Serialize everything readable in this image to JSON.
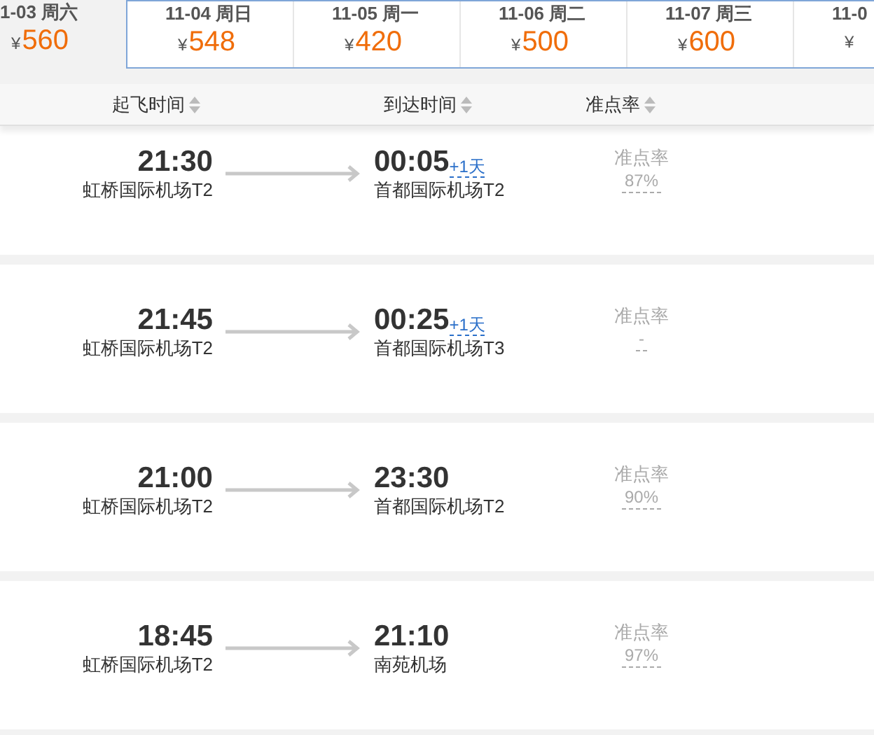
{
  "dates": [
    {
      "date": "1-03 周六",
      "currency": "¥",
      "price": "560",
      "selected": true
    },
    {
      "date": "11-04 周日",
      "currency": "¥",
      "price": "548",
      "selected": false
    },
    {
      "date": "11-05 周一",
      "currency": "¥",
      "price": "420",
      "selected": false
    },
    {
      "date": "11-06 周二",
      "currency": "¥",
      "price": "500",
      "selected": false
    },
    {
      "date": "11-07 周三",
      "currency": "¥",
      "price": "600",
      "selected": false
    },
    {
      "date": "11-0",
      "currency": "¥",
      "selected": false
    }
  ],
  "sort_headers": [
    "起飞时间",
    "到达时间",
    "准点率"
  ],
  "flights": [
    {
      "depart_time": "21:30",
      "depart_airport": "虹桥国际机场T2",
      "arrive_time": "00:05",
      "next_day": "+1天",
      "arrive_airport": "首都国际机场T2",
      "rate_label": "准点率",
      "rate": "87%"
    },
    {
      "depart_time": "21:45",
      "depart_airport": "虹桥国际机场T2",
      "arrive_time": "00:25",
      "next_day": "+1天",
      "arrive_airport": "首都国际机场T3",
      "rate_label": "准点率",
      "rate": "-"
    },
    {
      "depart_time": "21:00",
      "depart_airport": "虹桥国际机场T2",
      "arrive_time": "23:30",
      "arrive_airport": "首都国际机场T2",
      "rate_label": "准点率",
      "rate": "90%"
    },
    {
      "depart_time": "18:45",
      "depart_airport": "虹桥国际机场T2",
      "arrive_time": "21:10",
      "arrive_airport": "南苑机场",
      "rate_label": "准点率",
      "rate": "97%"
    }
  ]
}
